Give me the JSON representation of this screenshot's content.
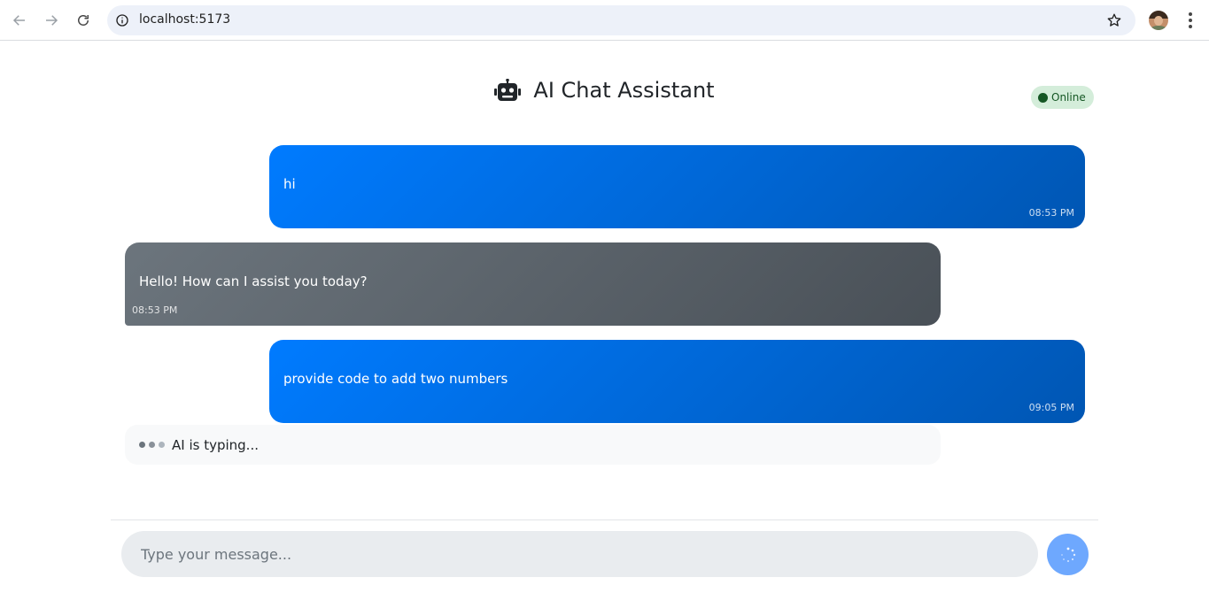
{
  "browser": {
    "url": "localhost:5173",
    "icons": {
      "back": "arrow-left-icon",
      "forward": "arrow-right-icon",
      "reload": "reload-icon",
      "info": "info-icon",
      "bookmark": "star-icon",
      "menu": "kebab-menu-icon"
    }
  },
  "app": {
    "title": "AI Chat Assistant",
    "status": "Online",
    "colors": {
      "user_bubble": "#007bff",
      "ai_bubble": "#6c757d",
      "status_bg": "#d4edda",
      "status_text": "#155724",
      "send_button": "#6ea8fe"
    }
  },
  "messages": [
    {
      "role": "user",
      "text": "hi",
      "time": "08:53 PM"
    },
    {
      "role": "ai",
      "text": "Hello! How can I assist you today?",
      "time": "08:53 PM"
    },
    {
      "role": "user",
      "text": "provide code to add two numbers",
      "time": "09:05 PM"
    }
  ],
  "typing": {
    "label": "AI is typing..."
  },
  "composer": {
    "placeholder": "Type your message...",
    "value": ""
  }
}
